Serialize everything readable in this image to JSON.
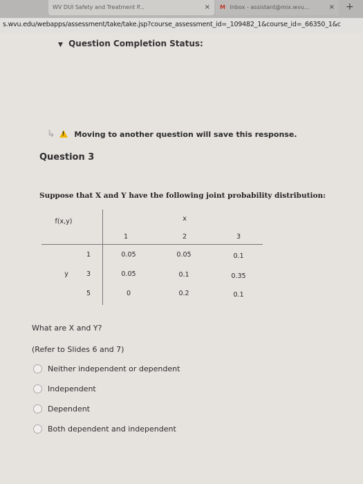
{
  "browser": {
    "tabs": [
      {
        "label": "WV DUI Safety and Treatment P...",
        "close": "×"
      },
      {
        "label": "Inbox - assistant@mix.wvu...",
        "close": "×"
      }
    ],
    "new_tab": "+",
    "url": "s.wvu.edu/webapps/assessment/take/take.jsp?course_assessment_id=_109482_1&course_id=_66350_1&c"
  },
  "page": {
    "status_title": "Question Completion Status:",
    "notice": "Moving to another question will save this response.",
    "question_title": "Question 3",
    "prompt": "Suppose that X and Y have the following joint probability distribution:",
    "table": {
      "corner": "f(x,y)",
      "x_label": "x",
      "y_label": "y",
      "x_values": [
        "1",
        "2",
        "3"
      ],
      "rows": [
        {
          "y": "1",
          "values": [
            "0.05",
            "0.05",
            "0.1"
          ]
        },
        {
          "y": "3",
          "values": [
            "0.05",
            "0.1",
            "0.35"
          ]
        },
        {
          "y": "5",
          "values": [
            "0",
            "0.2",
            "0.1"
          ]
        }
      ]
    },
    "question_text": "What are X and Y?",
    "hint": "(Refer to Slides 6 and 7)",
    "options": [
      "Neither independent or dependent",
      "Independent",
      "Dependent",
      "Both dependent and independent"
    ]
  }
}
